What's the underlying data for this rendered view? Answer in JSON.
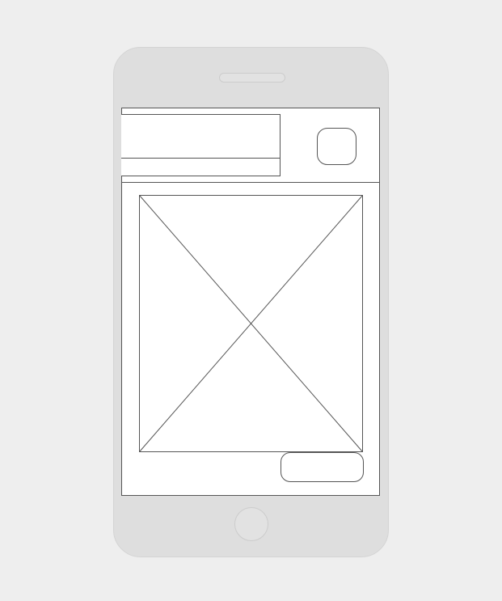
{
  "header": {
    "title": "",
    "subtitle": ""
  },
  "main": {
    "image_placeholder_icon": "image-placeholder-cross",
    "action_label": ""
  },
  "colors": {
    "background": "#eeeeee",
    "device": "#dedede",
    "screen": "#ffffff",
    "stroke": "#555555"
  }
}
